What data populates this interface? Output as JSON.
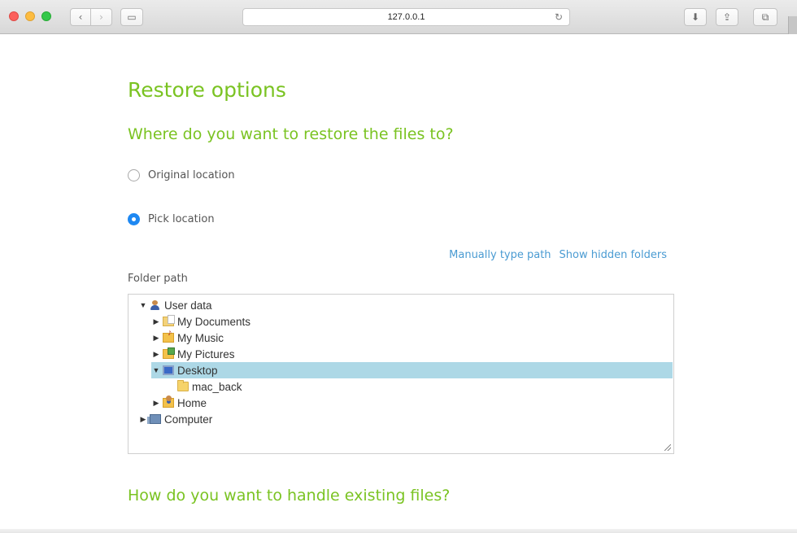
{
  "browser": {
    "url": "127.0.0.1",
    "back_glyph": "‹",
    "forward_glyph": "›",
    "sidebar_glyph": "▭",
    "reload_glyph": "↻",
    "download_glyph": "⬇",
    "share_glyph": "⇪",
    "tabs_glyph": "⧉"
  },
  "page": {
    "title": "Restore options",
    "restore_question": "Where do you want to restore the files to?",
    "options": [
      {
        "label": "Original location",
        "checked": false
      },
      {
        "label": "Pick location",
        "checked": true
      }
    ],
    "links": {
      "manual_path": "Manually type path",
      "show_hidden": "Show hidden folders"
    },
    "folder_label": "Folder path",
    "tree": [
      {
        "label": "User data",
        "icon": "user-icon",
        "expanded": true,
        "twisty": "▼"
      },
      {
        "label": "My Documents",
        "icon": "documents-folder-icon",
        "twisty": "▶"
      },
      {
        "label": "My Music",
        "icon": "music-folder-icon",
        "twisty": "▶"
      },
      {
        "label": "My Pictures",
        "icon": "pictures-folder-icon",
        "twisty": "▶"
      },
      {
        "label": "Desktop",
        "icon": "desktop-icon",
        "twisty": "▼",
        "selected": true
      },
      {
        "label": "mac_back",
        "icon": "folder-icon"
      },
      {
        "label": "Home",
        "icon": "home-folder-icon",
        "twisty": "▶"
      },
      {
        "label": "Computer",
        "icon": "computer-icon",
        "twisty": "▶"
      }
    ],
    "existing_question": "How do you want to handle existing files?"
  },
  "colors": {
    "heading_green": "#7ac322",
    "link_blue": "#4a9bd2",
    "selected_row": "#add8e6",
    "radio_blue": "#1e88f2"
  }
}
